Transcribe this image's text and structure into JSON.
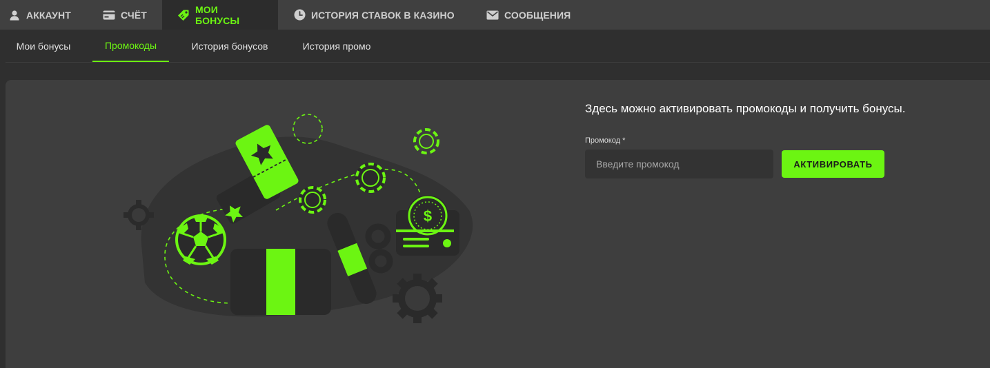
{
  "topnav": {
    "tabs": [
      {
        "label": "Аккаунт",
        "icon": "user-icon"
      },
      {
        "label": "Счёт",
        "icon": "card-icon"
      },
      {
        "label": "Мои бонусы",
        "icon": "tag-icon",
        "active": true
      },
      {
        "label": "История ставок в казино",
        "icon": "clock-icon"
      },
      {
        "label": "Сообщения",
        "icon": "mail-icon"
      }
    ]
  },
  "subnav": {
    "tabs": [
      {
        "label": "Мои бонусы"
      },
      {
        "label": "Промокоды",
        "active": true
      },
      {
        "label": "История бонусов"
      },
      {
        "label": "История промо"
      }
    ]
  },
  "promo": {
    "title": "Здесь можно активировать промокоды и получить бонусы.",
    "label": "Промокод *",
    "placeholder": "Введите промокод",
    "value": "",
    "button_label": "Активировать"
  },
  "colors": {
    "accent": "#6cf512",
    "nav_bg": "#404040",
    "page_bg": "#2f2f2f",
    "panel_bg": "#3e3e3e",
    "input_bg": "#333333"
  }
}
